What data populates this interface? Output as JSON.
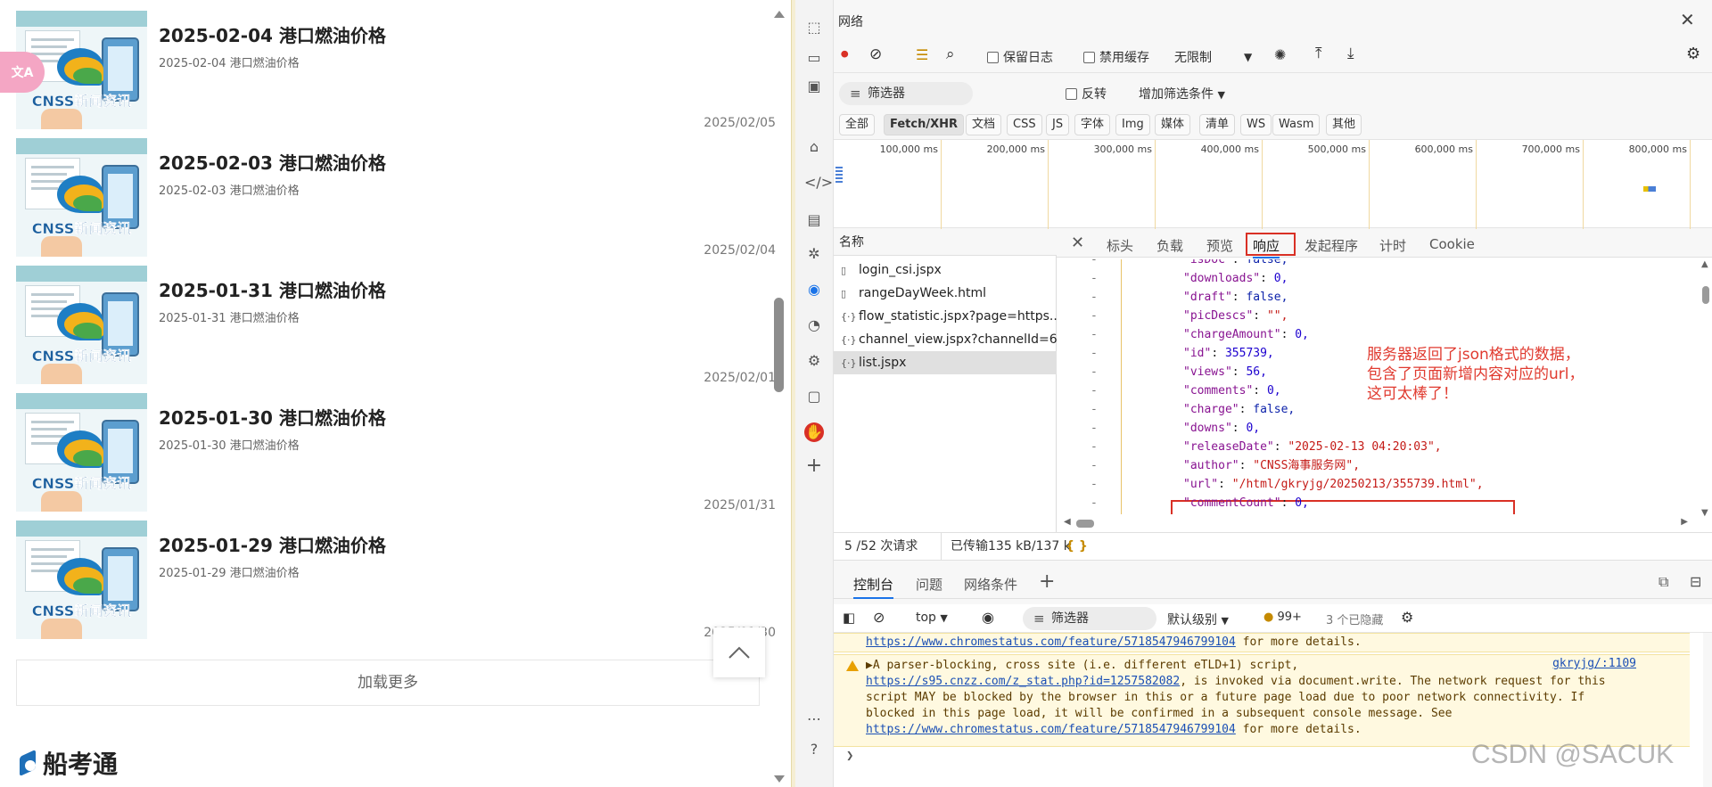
{
  "left": {
    "items": [
      {
        "title": "2025-02-04 港口燃油价格",
        "subtitle": "2025-02-04 港口燃油价格",
        "date": "2025/02/05",
        "thumb_caption": "CNSS新闻资讯"
      },
      {
        "title": "2025-02-03 港口燃油价格",
        "subtitle": "2025-02-03 港口燃油价格",
        "date": "2025/02/04",
        "thumb_caption": "CNSS新闻资讯"
      },
      {
        "title": "2025-01-31 港口燃油价格",
        "subtitle": "2025-01-31 港口燃油价格",
        "date": "2025/02/01",
        "thumb_caption": "CNSS新闻资讯"
      },
      {
        "title": "2025-01-30 港口燃油价格",
        "subtitle": "2025-01-30 港口燃油价格",
        "date": "2025/01/31",
        "thumb_caption": "CNSS新闻资讯"
      },
      {
        "title": "2025-01-29 港口燃油价格",
        "subtitle": "2025-01-29 港口燃油价格",
        "date": "2025/01/30",
        "thumb_caption": "CNSS新闻资讯"
      }
    ],
    "load_more": "加载更多",
    "brand": "船考通",
    "back_top_icon": "chevron-up-icon",
    "translate_badge": "文A"
  },
  "devtools": {
    "panel_title": "网络",
    "toolbar": {
      "preserve_log": "保留日志",
      "disable_cache": "禁用缓存",
      "throttle": "无限制"
    },
    "filter": {
      "placeholder": "筛选器",
      "invert": "反转",
      "more_filters": "增加筛选条件"
    },
    "types": [
      "全部",
      "Fetch/XHR",
      "文档",
      "CSS",
      "JS",
      "字体",
      "Img",
      "媒体",
      "清单",
      "WS",
      "Wasm",
      "其他"
    ],
    "active_type": "Fetch/XHR",
    "timeline_ticks": [
      "100,000 ms",
      "200,000 ms",
      "300,000 ms",
      "400,000 ms",
      "500,000 ms",
      "600,000 ms",
      "700,000 ms",
      "800,000 ms"
    ],
    "name_header": "名称",
    "requests": [
      {
        "name": "login_csi.jspx",
        "icon": "doc-icon"
      },
      {
        "name": "rangeDayWeek.html",
        "icon": "doc-icon"
      },
      {
        "name": "flow_statistic.jspx?page=https...",
        "icon": "xhr-icon"
      },
      {
        "name": "channel_view.jspx?channelId=63",
        "icon": "xhr-icon"
      },
      {
        "name": "list.jspx",
        "icon": "xhr-icon"
      }
    ],
    "selected_request": "list.jspx",
    "detail_tabs": [
      "标头",
      "负载",
      "预览",
      "响应",
      "发起程序",
      "计时",
      "Cookie"
    ],
    "active_detail_tab": "响应",
    "response_lines": [
      {
        "k": "\"isDoc\"",
        "v": "false,",
        "t": "bool"
      },
      {
        "k": "\"downloads\"",
        "v": "0,",
        "t": "num"
      },
      {
        "k": "\"draft\"",
        "v": "false,",
        "t": "bool"
      },
      {
        "k": "\"picDescs\"",
        "v": "\"\",",
        "t": "str"
      },
      {
        "k": "\"chargeAmount\"",
        "v": "0,",
        "t": "num"
      },
      {
        "k": "\"id\"",
        "v": "355739,",
        "t": "num"
      },
      {
        "k": "\"views\"",
        "v": "56,",
        "t": "num"
      },
      {
        "k": "\"comments\"",
        "v": "0,",
        "t": "num"
      },
      {
        "k": "\"charge\"",
        "v": "false,",
        "t": "bool"
      },
      {
        "k": "\"downs\"",
        "v": "0,",
        "t": "num"
      },
      {
        "k": "\"releaseDate\"",
        "v": "\"2025-02-13 04:20:03\",",
        "t": "str"
      },
      {
        "k": "\"author\"",
        "v": "\"CNSS海事服务网\",",
        "t": "str"
      },
      {
        "k": "\"url\"",
        "v": "\"/html/gkryjg/20250213/355739.html\",",
        "t": "str"
      },
      {
        "k": "\"commentCount\"",
        "v": "0,",
        "t": "num"
      }
    ],
    "annotation": [
      "服务器返回了json格式的数据，",
      "包含了页面新增内容对应的url，",
      "这可太棒了！"
    ],
    "status": {
      "requests": "5 /52 次请求",
      "transferred": "已传输135 kB/137 k",
      "braces": "{ }"
    },
    "drawer_tabs": [
      "控制台",
      "问题",
      "网络条件"
    ],
    "console_toolbar": {
      "context": "top",
      "filter_placeholder": "筛选器",
      "level": "默认级别",
      "issues_count": "99+",
      "hidden": "3 个已隐藏"
    },
    "console": {
      "line0_link": "https://www.chromestatus.com/feature/5718547946799104",
      "line0_tail": " for more details.",
      "warn_l1": "▶A parser-blocking, cross site (i.e. different eTLD+1) script,",
      "warn_l2_link": "https://s95.cnzz.com/z_stat.php?id=1257582082",
      "warn_l2_tail": ", is invoked via document.write. The network request for this",
      "warn_l3": "script MAY be blocked by the browser in this or a future page load due to poor network connectivity. If",
      "warn_l4": "blocked in this page load, it will be confirmed in a subsequent console message. See",
      "warn_l5_link": "https://www.chromestatus.com/feature/5718547946799104",
      "warn_l5_tail": " for more details.",
      "source": "gkryjg/:1109"
    }
  },
  "watermark": "CSDN @SACUK",
  "colors": {
    "annotation_red": "#e03a2f",
    "highlight_border": "#d93025",
    "accent_blue": "#1a73e8"
  }
}
